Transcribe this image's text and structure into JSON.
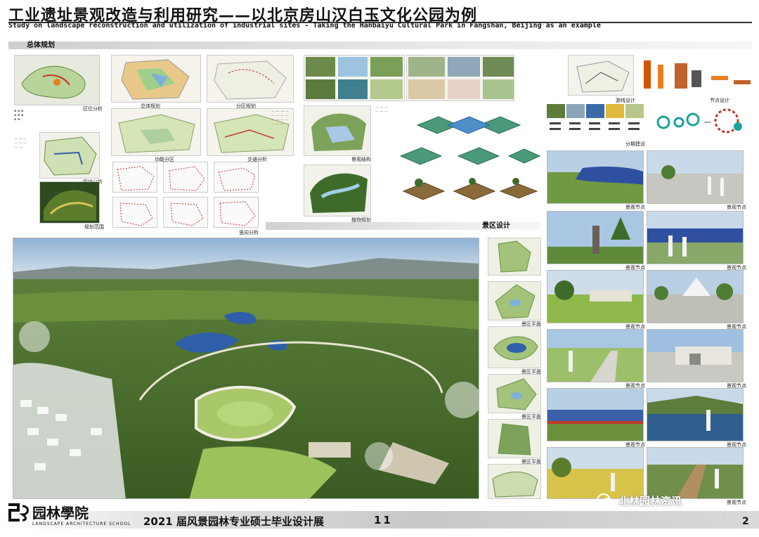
{
  "header": {
    "title_zh": "工业遗址景观改造与利用研究——以北京房山汉白玉文化公园为例",
    "title_en": "Study on landscape reconstruction and utilization of industrial sites - Taking the Hanbaiyu Cultural Park in Fangshan, Beijing as an example"
  },
  "sections": {
    "overall_planning": "总体规划",
    "scenic_design": "景区设计"
  },
  "plan_captions": [
    "区位分析",
    "现状分析",
    "规划范围",
    "总体规划",
    "分区规划",
    "功能分区",
    "交通分析",
    "竖向分析",
    "景观结构",
    "植物规划",
    "游线设计",
    "节点设计",
    "分期建设"
  ],
  "zone_captions": [
    "景区平面",
    "景区平面",
    "景区平面",
    "景区平面",
    "景区平面",
    "景区平面"
  ],
  "render_captions": [
    "景观节点",
    "景观节点",
    "景观节点",
    "景观节点",
    "景观节点",
    "景观节点",
    "景观节点",
    "景观节点",
    "景观节点",
    "景观节点",
    "景观节点"
  ],
  "footer": {
    "logo_name": "园林學院",
    "logo_sub": "LANDSCAPE ARCHITECTURE SCHOOL",
    "exhibition": "2021 届风景园林专业硕士毕业设计展",
    "number": "11",
    "page_mark": "2",
    "watermark": "北林园林资讯"
  },
  "colors": {
    "forest": "#3f6b2a",
    "lawn": "#8fb84a",
    "water": "#2f5fa8",
    "sky": "#c9d9ea"
  }
}
